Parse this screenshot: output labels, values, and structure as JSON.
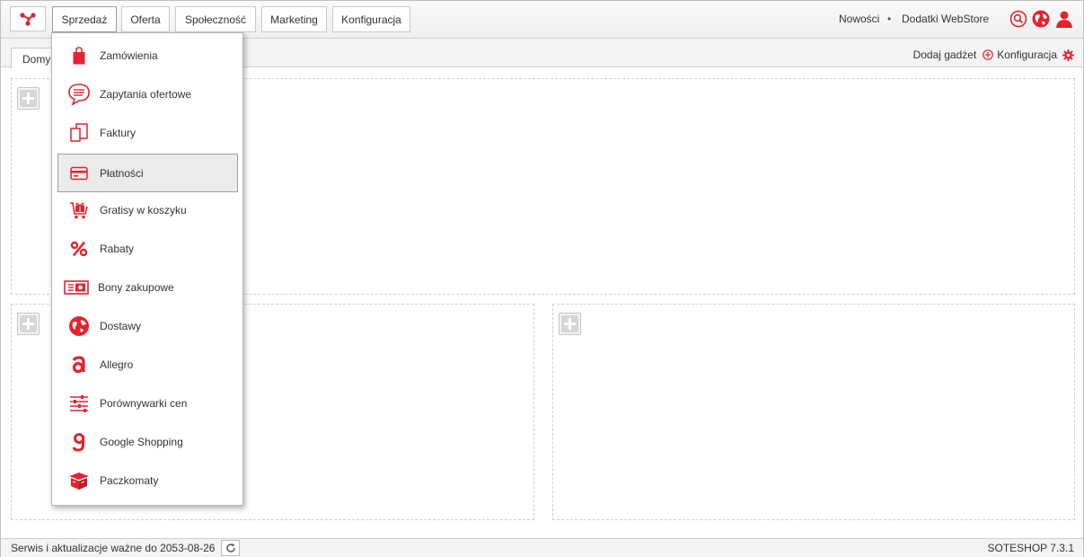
{
  "colors": {
    "accent": "#e4232f",
    "border": "#c8c8c8",
    "hover_bg": "#ebebeb"
  },
  "nav": {
    "logo_icon": "soteshop-logo-icon",
    "items": [
      {
        "label": "Sprzedaż",
        "active": true
      },
      {
        "label": "Oferta"
      },
      {
        "label": "Społeczność"
      },
      {
        "label": "Marketing"
      },
      {
        "label": "Konfiguracja"
      }
    ],
    "right_links": {
      "news": "Nowości",
      "separator": "•",
      "addons": "Dodatki WebStore"
    },
    "icons": [
      "search-icon",
      "globe-icon",
      "user-icon"
    ]
  },
  "tabs": {
    "active_label": "Domyślny"
  },
  "tab_actions": {
    "add_gadget": "Dodaj gadżet",
    "config": "Konfiguracja"
  },
  "dropdown": {
    "items": [
      {
        "label": "Zamówienia",
        "icon": "shopping-bag-icon"
      },
      {
        "label": "Zapytania ofertowe",
        "icon": "speech-bubble-icon"
      },
      {
        "label": "Faktury",
        "icon": "documents-icon"
      },
      {
        "label": "Płatności",
        "icon": "credit-card-icon",
        "highlighted": true
      },
      {
        "label": "Gratisy w koszyku",
        "icon": "gift-cart-icon"
      },
      {
        "label": "Rabaty",
        "icon": "percent-icon"
      },
      {
        "label": "Bony zakupowe",
        "icon": "voucher-icon"
      },
      {
        "label": "Dostawy",
        "icon": "delivery-globe-icon"
      },
      {
        "label": "Allegro",
        "icon": "allegro-icon"
      },
      {
        "label": "Porównywarki cen",
        "icon": "sliders-icon"
      },
      {
        "label": "Google Shopping",
        "icon": "google-shopping-icon"
      },
      {
        "label": "Paczkomaty",
        "icon": "parcel-box-icon"
      }
    ]
  },
  "footer": {
    "service_text": "Serwis i aktualizacje ważne do 2053-08-26",
    "version": "SOTESHOP 7.3.1"
  }
}
